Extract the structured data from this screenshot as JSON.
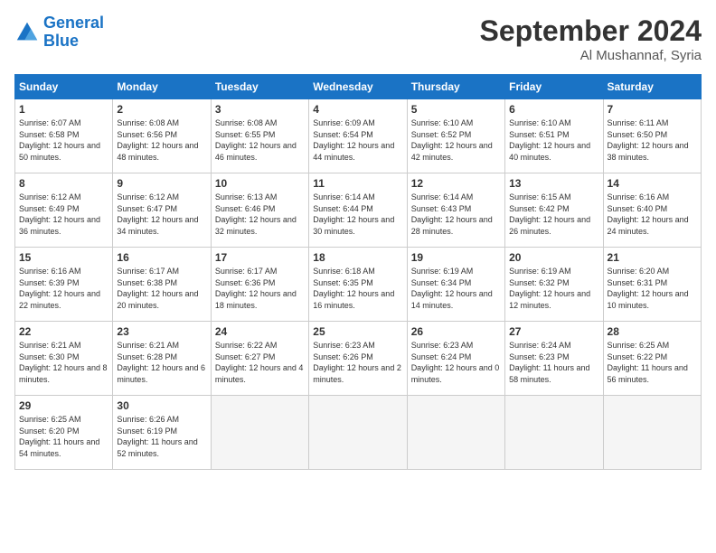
{
  "logo": {
    "line1": "General",
    "line2": "Blue"
  },
  "title": "September 2024",
  "location": "Al Mushannaf, Syria",
  "days_of_week": [
    "Sunday",
    "Monday",
    "Tuesday",
    "Wednesday",
    "Thursday",
    "Friday",
    "Saturday"
  ],
  "weeks": [
    [
      {
        "num": "1",
        "sunrise": "6:07 AM",
        "sunset": "6:58 PM",
        "daylight": "12 hours and 50 minutes."
      },
      {
        "num": "2",
        "sunrise": "6:08 AM",
        "sunset": "6:56 PM",
        "daylight": "12 hours and 48 minutes."
      },
      {
        "num": "3",
        "sunrise": "6:08 AM",
        "sunset": "6:55 PM",
        "daylight": "12 hours and 46 minutes."
      },
      {
        "num": "4",
        "sunrise": "6:09 AM",
        "sunset": "6:54 PM",
        "daylight": "12 hours and 44 minutes."
      },
      {
        "num": "5",
        "sunrise": "6:10 AM",
        "sunset": "6:52 PM",
        "daylight": "12 hours and 42 minutes."
      },
      {
        "num": "6",
        "sunrise": "6:10 AM",
        "sunset": "6:51 PM",
        "daylight": "12 hours and 40 minutes."
      },
      {
        "num": "7",
        "sunrise": "6:11 AM",
        "sunset": "6:50 PM",
        "daylight": "12 hours and 38 minutes."
      }
    ],
    [
      {
        "num": "8",
        "sunrise": "6:12 AM",
        "sunset": "6:49 PM",
        "daylight": "12 hours and 36 minutes."
      },
      {
        "num": "9",
        "sunrise": "6:12 AM",
        "sunset": "6:47 PM",
        "daylight": "12 hours and 34 minutes."
      },
      {
        "num": "10",
        "sunrise": "6:13 AM",
        "sunset": "6:46 PM",
        "daylight": "12 hours and 32 minutes."
      },
      {
        "num": "11",
        "sunrise": "6:14 AM",
        "sunset": "6:44 PM",
        "daylight": "12 hours and 30 minutes."
      },
      {
        "num": "12",
        "sunrise": "6:14 AM",
        "sunset": "6:43 PM",
        "daylight": "12 hours and 28 minutes."
      },
      {
        "num": "13",
        "sunrise": "6:15 AM",
        "sunset": "6:42 PM",
        "daylight": "12 hours and 26 minutes."
      },
      {
        "num": "14",
        "sunrise": "6:16 AM",
        "sunset": "6:40 PM",
        "daylight": "12 hours and 24 minutes."
      }
    ],
    [
      {
        "num": "15",
        "sunrise": "6:16 AM",
        "sunset": "6:39 PM",
        "daylight": "12 hours and 22 minutes."
      },
      {
        "num": "16",
        "sunrise": "6:17 AM",
        "sunset": "6:38 PM",
        "daylight": "12 hours and 20 minutes."
      },
      {
        "num": "17",
        "sunrise": "6:17 AM",
        "sunset": "6:36 PM",
        "daylight": "12 hours and 18 minutes."
      },
      {
        "num": "18",
        "sunrise": "6:18 AM",
        "sunset": "6:35 PM",
        "daylight": "12 hours and 16 minutes."
      },
      {
        "num": "19",
        "sunrise": "6:19 AM",
        "sunset": "6:34 PM",
        "daylight": "12 hours and 14 minutes."
      },
      {
        "num": "20",
        "sunrise": "6:19 AM",
        "sunset": "6:32 PM",
        "daylight": "12 hours and 12 minutes."
      },
      {
        "num": "21",
        "sunrise": "6:20 AM",
        "sunset": "6:31 PM",
        "daylight": "12 hours and 10 minutes."
      }
    ],
    [
      {
        "num": "22",
        "sunrise": "6:21 AM",
        "sunset": "6:30 PM",
        "daylight": "12 hours and 8 minutes."
      },
      {
        "num": "23",
        "sunrise": "6:21 AM",
        "sunset": "6:28 PM",
        "daylight": "12 hours and 6 minutes."
      },
      {
        "num": "24",
        "sunrise": "6:22 AM",
        "sunset": "6:27 PM",
        "daylight": "12 hours and 4 minutes."
      },
      {
        "num": "25",
        "sunrise": "6:23 AM",
        "sunset": "6:26 PM",
        "daylight": "12 hours and 2 minutes."
      },
      {
        "num": "26",
        "sunrise": "6:23 AM",
        "sunset": "6:24 PM",
        "daylight": "12 hours and 0 minutes."
      },
      {
        "num": "27",
        "sunrise": "6:24 AM",
        "sunset": "6:23 PM",
        "daylight": "11 hours and 58 minutes."
      },
      {
        "num": "28",
        "sunrise": "6:25 AM",
        "sunset": "6:22 PM",
        "daylight": "11 hours and 56 minutes."
      }
    ],
    [
      {
        "num": "29",
        "sunrise": "6:25 AM",
        "sunset": "6:20 PM",
        "daylight": "11 hours and 54 minutes."
      },
      {
        "num": "30",
        "sunrise": "6:26 AM",
        "sunset": "6:19 PM",
        "daylight": "11 hours and 52 minutes."
      },
      null,
      null,
      null,
      null,
      null
    ]
  ]
}
